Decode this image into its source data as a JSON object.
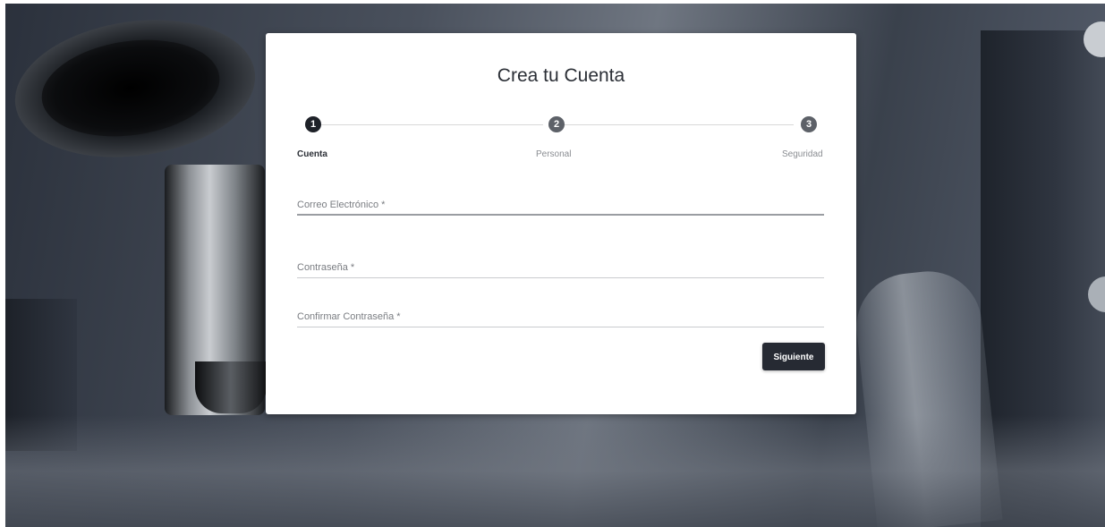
{
  "card": {
    "title": "Crea tu Cuenta"
  },
  "stepper": {
    "steps": [
      {
        "number": "1",
        "label": "Cuenta",
        "state": "active"
      },
      {
        "number": "2",
        "label": "Personal",
        "state": "inactive"
      },
      {
        "number": "3",
        "label": "Seguridad",
        "state": "inactive"
      }
    ]
  },
  "form": {
    "email_label": "Correo Electrónico *",
    "password_label": "Contraseña *",
    "confirm_password_label": "Confirmar Contraseña *",
    "next_label": "Siguiente"
  },
  "colors": {
    "button_bg": "#262a33",
    "active_step": "#1e2128",
    "inactive_step": "#5d6168"
  }
}
